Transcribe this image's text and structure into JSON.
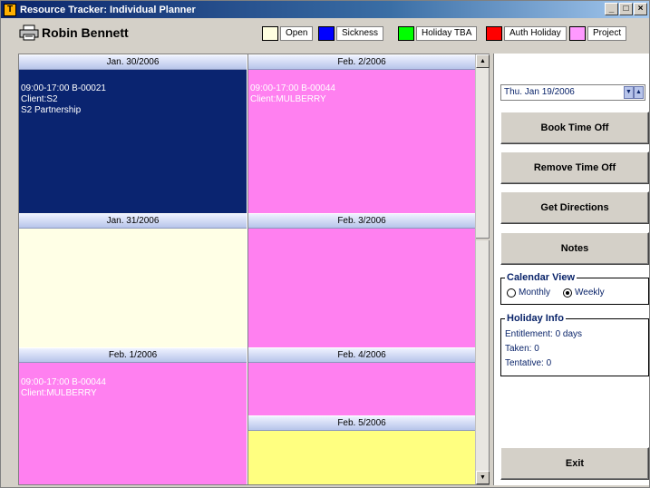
{
  "window": {
    "title": "Resource Tracker: Individual Planner",
    "icon": "T"
  },
  "header": {
    "person": "Robin Bennett"
  },
  "legend": [
    {
      "label": "Open",
      "color": "#ffffe0"
    },
    {
      "label": "Sickness",
      "color": "#0000ff"
    },
    {
      "label": "Holiday TBA",
      "color": "#00ff00"
    },
    {
      "label": "Auth Holiday",
      "color": "#ff0000"
    },
    {
      "label": "Project",
      "color": "#ff99ff"
    }
  ],
  "days": {
    "d1": {
      "date": "Jan. 30/2006",
      "line1": "09:00-17:00 B-00021",
      "line2": "Client:S2",
      "line3": "S2 Partnership",
      "color": "#0a2470"
    },
    "d2": {
      "date": "Jan. 31/2006",
      "color": "#ffffe6"
    },
    "d3": {
      "date": "Feb. 1/2006",
      "line1": "09:00-17:00 B-00044",
      "line2": "Client:MULBERRY",
      "color": "#ff80f0"
    },
    "d4": {
      "date": "Feb. 2/2006",
      "line1": "09:00-17:00 B-00044",
      "line2": "Client:MULBERRY",
      "color": "#ff80f0"
    },
    "d5": {
      "date": "Feb. 3/2006",
      "color": "#ff80f0"
    },
    "d6": {
      "date": "Feb. 4/2006",
      "color": "#ff80f0"
    },
    "d7": {
      "date": "Feb. 5/2006",
      "color": "#ffff80"
    }
  },
  "sidebar": {
    "date_value": "Thu. Jan 19/2006",
    "book_time_off": "Book Time Off",
    "remove_time_off": "Remove Time Off",
    "get_directions": "Get Directions",
    "notes": "Notes",
    "calendar_view": {
      "title": "Calendar View",
      "monthly": "Monthly",
      "weekly": "Weekly",
      "selected": "Weekly"
    },
    "holiday_info": {
      "title": "Holiday Info",
      "entitlement": "Entitlement: 0 days",
      "taken": "Taken: 0",
      "tentative": "Tentative: 0"
    },
    "exit": "Exit"
  }
}
